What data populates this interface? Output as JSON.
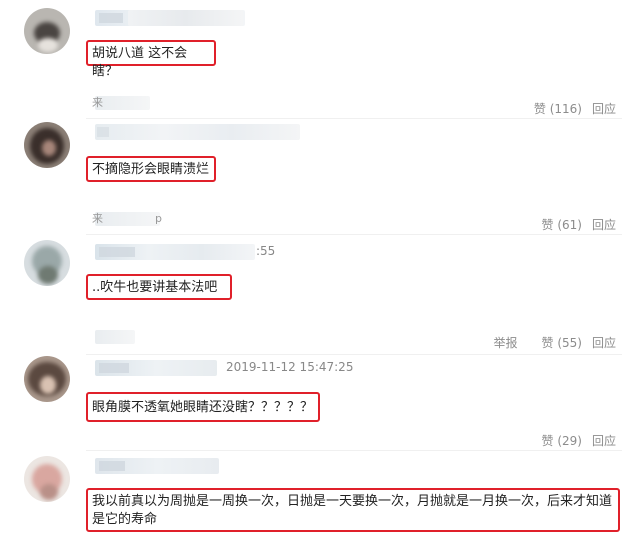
{
  "comments": [
    {
      "user_blur": "",
      "text": "胡说八道 这不会瞎？",
      "like_label": "",
      "reply_label": ""
    },
    {
      "source_prefix": "来",
      "text": "不摘隐形会眼睛溃烂",
      "like_label": "赞 (116)",
      "reply_label": "回应"
    },
    {
      "source_prefix": "来",
      "source_suffix": "p",
      "time_fragment": ":55",
      "text": "..吹牛也要讲基本法吧",
      "like_label": "赞 (61)",
      "reply_label": "回应"
    },
    {
      "report_label": "举报",
      "like_label": "赞 (55)",
      "reply_label": "回应",
      "timestamp": "2019-11-12 15:47:25",
      "text": "眼角膜不透氧她眼睛还没瞎？？？？？"
    },
    {
      "like_label": "赞 (29)",
      "reply_label": "回应",
      "text": "我以前真以为周抛是一周换一次，日抛是一天要换一次，月抛就是一月换一次，后来才知道是它的寿命"
    }
  ]
}
